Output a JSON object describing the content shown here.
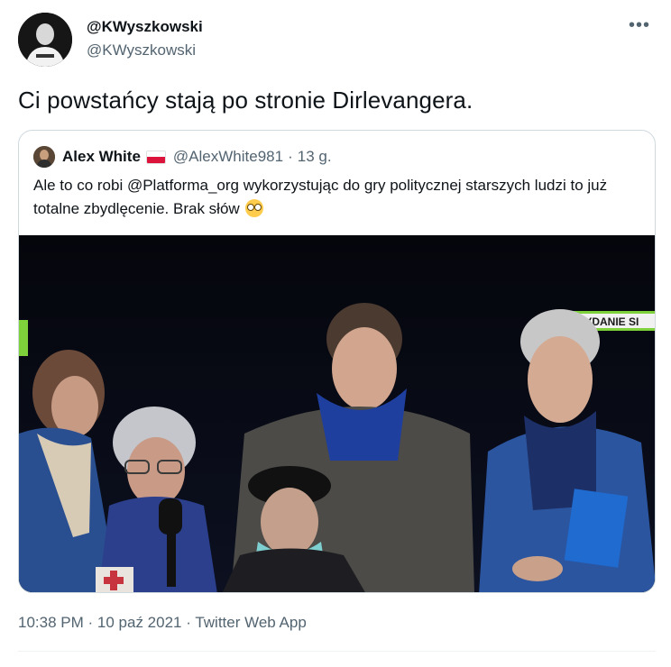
{
  "tweet": {
    "author_name": "@KWyszkowski",
    "author_handle": "@KWyszkowski",
    "more_label": "•••",
    "text": "Ci powstańcy stają po stronie Dirlevangera.",
    "time": "10:38 PM",
    "date": "10 paź 2021",
    "separator": "·",
    "source": "Twitter Web App"
  },
  "quote": {
    "name": "Alex White",
    "handle": "@AlexWhite981",
    "separator": "·",
    "time": "13 g.",
    "text": "Ale to co robi @Platforma_org wykorzystując do gry politycznej starszych ludzi to już totalne zbydlęcenie. Brak słów",
    "flag_colors": [
      "#ffffff",
      "#dc143c"
    ],
    "media": {
      "overlay_label": "WYDANIE SI"
    }
  }
}
